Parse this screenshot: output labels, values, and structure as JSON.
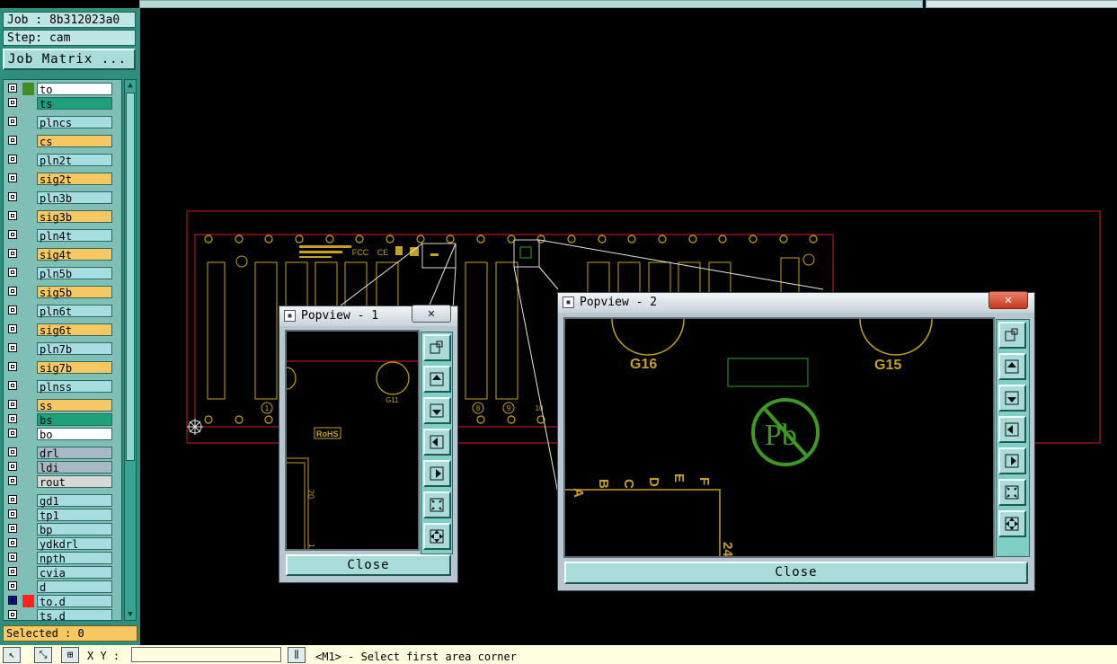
{
  "job_label": "Job : 8b312023a0",
  "step_label": "Step: cam",
  "job_matrix_button": "Job Matrix ...",
  "layers": [
    {
      "name": "to",
      "color": "#ffffff",
      "swatch": "#3f8f1f",
      "sel": false
    },
    {
      "name": "ts",
      "color": "#1f9f7a",
      "swatch": "",
      "sel": false
    },
    {
      "name": "plncs",
      "color": "#a6dde0",
      "swatch": "",
      "sel": false
    },
    {
      "name": "cs",
      "color": "#f7c862",
      "swatch": "",
      "sel": false
    },
    {
      "name": "pln2t",
      "color": "#a6dde0",
      "swatch": "",
      "sel": false
    },
    {
      "name": "sig2t",
      "color": "#f7c862",
      "swatch": "",
      "sel": false
    },
    {
      "name": "pln3b",
      "color": "#a6dde0",
      "swatch": "",
      "sel": false
    },
    {
      "name": "sig3b",
      "color": "#f7c862",
      "swatch": "",
      "sel": false
    },
    {
      "name": "pln4t",
      "color": "#a6dde0",
      "swatch": "",
      "sel": false
    },
    {
      "name": "sig4t",
      "color": "#f7c862",
      "swatch": "",
      "sel": false
    },
    {
      "name": "pln5b",
      "color": "#a6dde0",
      "swatch": "",
      "sel": false
    },
    {
      "name": "sig5b",
      "color": "#f7c862",
      "swatch": "",
      "sel": false
    },
    {
      "name": "pln6t",
      "color": "#a6dde0",
      "swatch": "",
      "sel": false
    },
    {
      "name": "sig6t",
      "color": "#f7c862",
      "swatch": "",
      "sel": false
    },
    {
      "name": "pln7b",
      "color": "#a6dde0",
      "swatch": "",
      "sel": false
    },
    {
      "name": "sig7b",
      "color": "#f7c862",
      "swatch": "",
      "sel": false
    },
    {
      "name": "plnss",
      "color": "#a6dde0",
      "swatch": "",
      "sel": false
    },
    {
      "name": "ss",
      "color": "#f7c862",
      "swatch": "",
      "sel": false
    },
    {
      "name": "bs",
      "color": "#1f9f7a",
      "swatch": "",
      "sel": false
    },
    {
      "name": "bo",
      "color": "#ffffff",
      "swatch": "",
      "sel": false
    },
    {
      "name": "drl",
      "color": "#a8b8c4",
      "swatch": "",
      "sel": false
    },
    {
      "name": "ldi",
      "color": "#a8b8c4",
      "swatch": "",
      "sel": false
    },
    {
      "name": "rout",
      "color": "#d8d8d8",
      "swatch": "",
      "sel": false
    },
    {
      "name": "gd1",
      "color": "#a6dde0",
      "swatch": "",
      "sel": false
    },
    {
      "name": "tp1",
      "color": "#a6dde0",
      "swatch": "",
      "sel": false
    },
    {
      "name": "bp",
      "color": "#a6dde0",
      "swatch": "",
      "sel": false
    },
    {
      "name": "ydkdrl",
      "color": "#a6dde0",
      "swatch": "",
      "sel": false
    },
    {
      "name": "npth",
      "color": "#a6dde0",
      "swatch": "",
      "sel": false
    },
    {
      "name": "cvia",
      "color": "#a6dde0",
      "swatch": "",
      "sel": false
    },
    {
      "name": "d",
      "color": "#a6dde0",
      "swatch": "",
      "sel": false
    },
    {
      "name": "to.d",
      "color": "#a6dde0",
      "swatch": "#ff2020",
      "sel": true
    },
    {
      "name": "ts.d",
      "color": "#a6dde0",
      "swatch": "",
      "sel": false
    }
  ],
  "selected_label": "Selected : 0",
  "xy_label": "X Y :",
  "xy_value": "",
  "status_message": "<M1> - Select first area corner",
  "popup1": {
    "title": "Popview - 1",
    "close_label": "Close",
    "x_label": "✕",
    "rohs": "RoHS",
    "g11": "G11",
    "num20": "20",
    "num1": "1"
  },
  "popup2": {
    "title": "Popview - 2",
    "close_label": "Close",
    "x_label": "✕",
    "g16": "G16",
    "g15": "G15",
    "letters": [
      "A",
      "B",
      "C",
      "D",
      "E",
      "F"
    ],
    "num24": "24",
    "pb": "Pb"
  },
  "board_marks": {
    "fcc": "FCC",
    "ce": "CE",
    "n1": "1",
    "n8": "8",
    "n9": "9",
    "n10": "10"
  },
  "colors": {
    "board_outline": "#d42020",
    "silkscreen": "#c8a020",
    "canvas": "#000000",
    "panel": "#2f8f7f",
    "accent": "#f7c862"
  }
}
